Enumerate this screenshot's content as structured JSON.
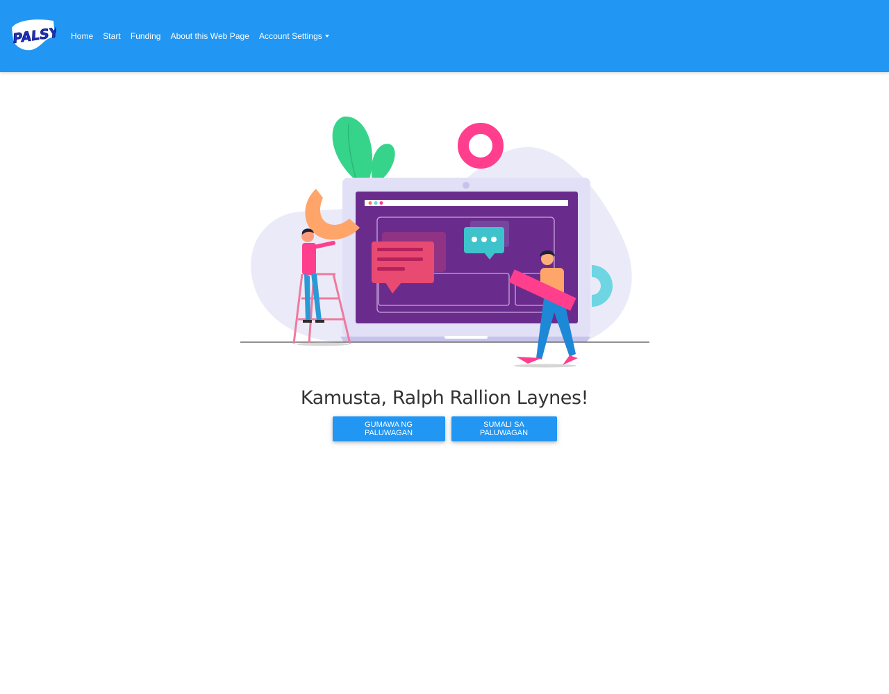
{
  "navbar": {
    "logo_text": "PALSYS",
    "links": [
      "Home",
      "Start",
      "Funding",
      "About this Web Page"
    ],
    "account_settings": "Account Settings",
    "background": "#2196f3"
  },
  "hero_image": {
    "icon": "web-development-illustration"
  },
  "main": {
    "greeting": "Kamusta, Ralph Rallion Laynes!",
    "buttons": {
      "create": "GUMAWA NG PALUWAGAN",
      "join": "SUMALI SA PALUWAGAN"
    }
  },
  "colors": {
    "primary": "#2196f3",
    "text": "#333333"
  }
}
